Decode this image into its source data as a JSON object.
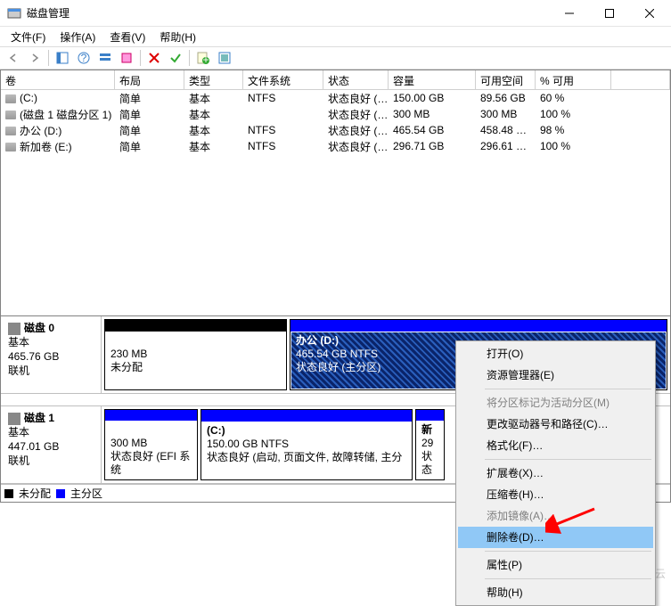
{
  "window": {
    "title": "磁盘管理"
  },
  "menu": {
    "file": "文件(F)",
    "action": "操作(A)",
    "view": "查看(V)",
    "help": "帮助(H)"
  },
  "columns": {
    "volume": "卷",
    "layout": "布局",
    "type": "类型",
    "filesystem": "文件系统",
    "status": "状态",
    "capacity": "容量",
    "free": "可用空间",
    "percent": "% 可用"
  },
  "rows": [
    {
      "vol": "(C:)",
      "layout": "简单",
      "type": "基本",
      "fs": "NTFS",
      "status": "状态良好 (…",
      "cap": "150.00 GB",
      "free": "89.56 GB",
      "pct": "60 %"
    },
    {
      "vol": "(磁盘 1 磁盘分区 1)",
      "layout": "简单",
      "type": "基本",
      "fs": "",
      "status": "状态良好 (…",
      "cap": "300 MB",
      "free": "300 MB",
      "pct": "100 %"
    },
    {
      "vol": "办公 (D:)",
      "layout": "简单",
      "type": "基本",
      "fs": "NTFS",
      "status": "状态良好 (…",
      "cap": "465.54 GB",
      "free": "458.48 …",
      "pct": "98 %"
    },
    {
      "vol": "新加卷 (E:)",
      "layout": "简单",
      "type": "基本",
      "fs": "NTFS",
      "status": "状态良好 (…",
      "cap": "296.71 GB",
      "free": "296.61 …",
      "pct": "100 %"
    }
  ],
  "disk0": {
    "name": "磁盘 0",
    "type": "基本",
    "size": "465.76 GB",
    "state": "联机",
    "part0": {
      "size": "230 MB",
      "label": "未分配"
    },
    "part1": {
      "title": "办公 (D:)",
      "size": "465.54 GB NTFS",
      "status": "状态良好 (主分区)"
    }
  },
  "disk1": {
    "name": "磁盘 1",
    "type": "基本",
    "size": "447.01 GB",
    "state": "联机",
    "part0": {
      "size": "300 MB",
      "status": "状态良好 (EFI 系统"
    },
    "part1": {
      "title": "(C:)",
      "size": "150.00 GB NTFS",
      "status": "状态良好 (启动, 页面文件, 故障转储, 主分"
    },
    "part2": {
      "title": "新",
      "size": "29",
      "status": "状态"
    }
  },
  "legend": {
    "unalloc": "未分配",
    "primary": "主分区"
  },
  "ctx": {
    "open": "打开(O)",
    "explorer": "资源管理器(E)",
    "mark_active": "将分区标记为活动分区(M)",
    "change_letter": "更改驱动器号和路径(C)…",
    "format": "格式化(F)…",
    "extend": "扩展卷(X)…",
    "shrink": "压缩卷(H)…",
    "mirror": "添加镜像(A)…",
    "delete": "删除卷(D)…",
    "properties": "属性(P)",
    "help": "帮助(H)"
  },
  "watermark": "亿速云"
}
